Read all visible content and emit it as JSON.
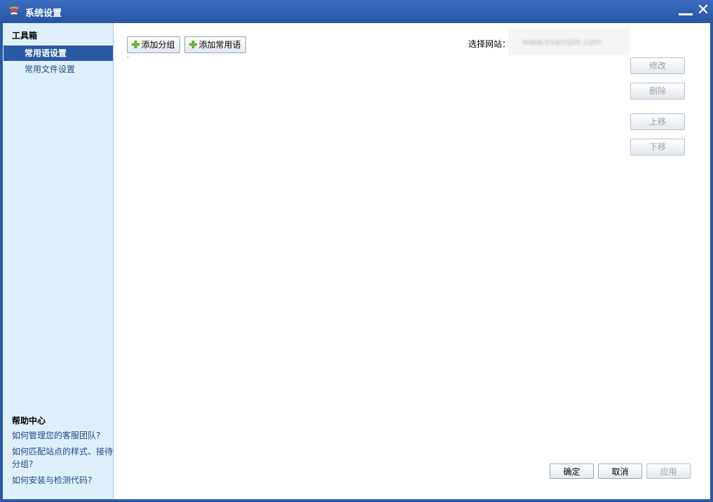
{
  "window": {
    "title": "系统设置"
  },
  "sidebar": {
    "toolbox_title": "工具箱",
    "items": [
      {
        "label": "常用语设置",
        "active": true
      },
      {
        "label": "常用文件设置",
        "active": false
      }
    ],
    "help": {
      "title": "帮助中心",
      "links": [
        "如何管理您的客服团队?",
        "如何匹配站点的样式、接待分组?",
        "如何安装与检测代码?"
      ]
    }
  },
  "toolbar": {
    "add_group": "添加分组",
    "add_phrase": "添加常用语",
    "site_label": "选择网站：",
    "site_value": "www.example.com"
  },
  "side_actions": {
    "edit": "修改",
    "delete": "删除",
    "move_up": "上移",
    "move_down": "下移"
  },
  "footer": {
    "ok": "确定",
    "cancel": "取消",
    "apply": "应用"
  },
  "colors": {
    "title_bar": "#2a5aa6",
    "sidebar_bg": "#e0f0fb",
    "active_item": "#2a5aa6",
    "link": "#1d4a8a"
  }
}
